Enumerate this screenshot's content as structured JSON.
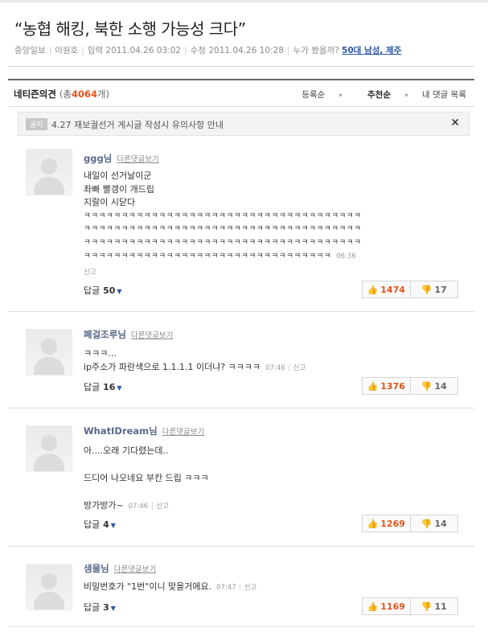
{
  "article": {
    "title": "“농협 해킹, 북한 소행 가능성 크다”",
    "press": "중앙일보",
    "reporter": "이원호",
    "input_label": "입력",
    "input_time": "2011.04.26 03:02",
    "edit_label": "수정",
    "edit_time": "2011.04.26 10:28",
    "who_read": "누가 봤을까?",
    "who_read_top": "50대 남성, 제주"
  },
  "comments_header": {
    "label": "네티즌의견",
    "count_prefix": "(총",
    "count": "4064",
    "count_suffix": "개)",
    "sort_register": "등록순",
    "sort_recommend": "추천순",
    "my_comments": "내 댓글 목록"
  },
  "notice": {
    "tag": "공지",
    "text": "4.27 재보궐선거 게시글 작성시 유의사항 안내",
    "close": "✕"
  },
  "comments": [
    {
      "author": "ggg님",
      "reply_link": "다른댓글보기",
      "lines": [
        "내일이 선거날이군",
        "좌빠 빨갱이 개드립",
        "지랄이 시닫다",
        "ㅋㅋㅋㅋㅋㅋㅋㅋㅋㅋㅋㅋㅋㅋㅋㅋㅋㅋㅋㅋㅋㅋㅋㅋㅋㅋㅋㅋㅋㅋㅋㅋㅋㅋㅋㅋㅋ",
        "ㅋㅋㅋㅋㅋㅋㅋㅋㅋㅋㅋㅋㅋㅋㅋㅋㅋㅋㅋㅋㅋㅋㅋㅋㅋㅋㅋㅋㅋㅋㅋㅋㅋㅋㅋㅋㅋ",
        "ㅋㅋㅋㅋㅋㅋㅋㅋㅋㅋㅋㅋㅋㅋㅋㅋㅋㅋㅋㅋㅋㅋㅋㅋㅋㅋㅋㅋㅋㅋㅋㅋㅋㅋㅋㅋㅋ"
      ],
      "last_line": "ㅋㅋㅋㅋㅋㅋㅋㅋㅋㅋㅋㅋㅋㅋㅋㅋㅋㅋㅋㅋㅋㅋㅋㅋㅋㅋㅋㅋㅋㅋㅋㅋㅋ",
      "time": "06:36",
      "report": "신고",
      "reply_label": "답글",
      "reply_count": "50",
      "up": "1474",
      "down": "17"
    },
    {
      "author": "폐걸조루님",
      "reply_link": "다른댓글보기",
      "lines": [
        "ㅋㅋㅋ..."
      ],
      "last_line": "ip주소가 파란색으로 1.1.1.1 이더냐? ㅋㅋㅋㅋ",
      "time": "07:46",
      "report": "신고",
      "reply_label": "답글",
      "reply_count": "16",
      "up": "1376",
      "down": "14"
    },
    {
      "author": "WhatIDream님",
      "reply_link": "다른댓글보기",
      "lines": [
        "아....오래 기다렸는데..",
        "",
        "드디어 나오네요 부칸 드립 ㅋㅋㅋ",
        ""
      ],
      "last_line": "방가방가~",
      "time": "07:46",
      "report": "신고",
      "reply_label": "답글",
      "reply_count": "4",
      "up": "1269",
      "down": "14"
    },
    {
      "author": "샘물님",
      "reply_link": "다른댓글보기",
      "lines": [],
      "last_line": "비밀번호가 \"1번\"이니 맞을거에요.",
      "time": "07:47",
      "report": "신고",
      "reply_label": "답글",
      "reply_count": "3",
      "up": "1169",
      "down": "11"
    }
  ]
}
